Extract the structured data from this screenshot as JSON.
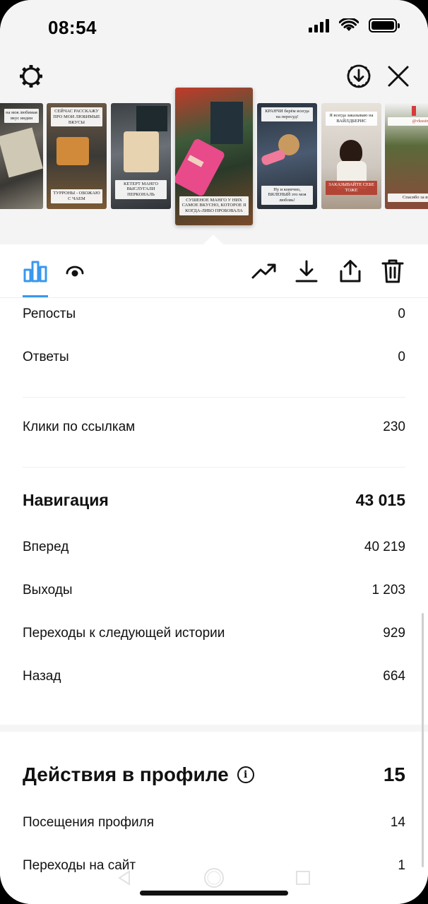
{
  "status": {
    "time": "08:54"
  },
  "stories": [
    {
      "caption": "на моя любимая вкус индии",
      "caption_bottom": "",
      "bg": "#3a3a36",
      "accent": "#c8c2b0"
    },
    {
      "caption": "СЕЙЧАС РАССКАЖУ ПРО МОИ ЛЮБИМЫЕ ВКУСЫ",
      "caption_bottom": "ТУРРОНЫ - ОБОЖАЮ С ЧАЕМ",
      "bg": "#5a4a3a",
      "accent": "#d08a3a"
    },
    {
      "caption": "",
      "caption_bottom": "КЕТЕРТ МАНГО ВЫСЛУГАЛИ ПЕРКОНАЛЬ",
      "bg": "#4a4e52",
      "accent": "#e2b27a"
    },
    {
      "caption": "",
      "caption_bottom": "СУШЕНОЕ МАНГО У НИХ САМОЕ ВКУСНО, КОТОРОЕ Я КОГДА-ЛИБО ПРОБОВАЛА",
      "bg": "#3e5a3a",
      "accent": "#e84a8a"
    },
    {
      "caption": "КРАНЧИ берём всегда на пересуд!",
      "caption_bottom": "Ну и конечно, ВЯЛЕНЫЙ это моя любовь!",
      "bg": "#2f3a44",
      "accent": "#c99a60"
    },
    {
      "caption": "Я всегда заказываю на ВАЙЛДБЕРИС",
      "caption_bottom": "ЗАКАЗЫВАЙТЕ СЕБЕ ТОЖЕ",
      "bg": "#cfc8c0",
      "accent": "#b23a2a"
    },
    {
      "caption": "@vkusimira",
      "caption_bottom": "Спасибо за внимание",
      "bg": "#5a6a3a",
      "accent": "#d83a3a"
    }
  ],
  "stats": {
    "reposts": {
      "label": "Репосты",
      "value": "0"
    },
    "replies": {
      "label": "Ответы",
      "value": "0"
    },
    "link_clicks": {
      "label": "Клики по ссылкам",
      "value": "230"
    },
    "navigation": {
      "title": "Навигация",
      "value": "43 015",
      "forward": {
        "label": "Вперед",
        "value": "40 219"
      },
      "exits": {
        "label": "Выходы",
        "value": "1 203"
      },
      "next_story": {
        "label": "Переходы к следующей истории",
        "value": "929"
      },
      "back": {
        "label": "Назад",
        "value": "664"
      }
    },
    "profile_actions": {
      "title": "Действия в профиле",
      "value": "15",
      "visits": {
        "label": "Посещения профиля",
        "value": "14"
      },
      "site_clicks": {
        "label": "Переходы на сайт",
        "value": "1"
      }
    }
  },
  "colors": {
    "accent": "#3897f0"
  }
}
